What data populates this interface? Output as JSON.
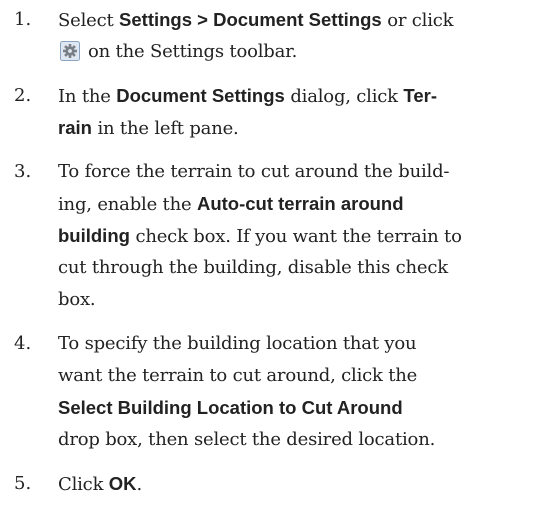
{
  "steps": [
    {
      "number": "1.",
      "line1": {
        "t1": "Select ",
        "b1": "Settings > Document Settings",
        "t2": " or click"
      },
      "line2": {
        "t1": "on the Settings toolbar."
      },
      "icon": "document-settings-gear-icon"
    },
    {
      "number": "2.",
      "line1": {
        "t1": "In the ",
        "b1": "Document Settings",
        "t2": " dialog, click ",
        "b2": "Ter-"
      },
      "line2": {
        "b1": "rain",
        "t1": " in the left pane."
      }
    },
    {
      "number": "3.",
      "line1": {
        "t1": "To force the terrain to cut around the build-"
      },
      "line2": {
        "t1": "ing, enable the ",
        "b1": "Auto-cut terrain around"
      },
      "line3": {
        "b1": "building",
        "t1": " check box. If you want the terrain to"
      },
      "line4": {
        "t1": "cut through the building, disable this check"
      },
      "line5": {
        "t1": "box."
      }
    },
    {
      "number": "4.",
      "line1": {
        "t1": "To specify the building location that you"
      },
      "line2": {
        "t1": "want the terrain to cut around, click the"
      },
      "line3": {
        "b1": "Select Building Location to Cut Around"
      },
      "line4": {
        "t1": "drop box, then select the desired location."
      }
    },
    {
      "number": "5.",
      "line1": {
        "t1": "Click ",
        "b1": "OK",
        "t2": "."
      }
    }
  ],
  "colors": {
    "text": "#222222",
    "icon_bg": "#dfe8f2",
    "icon_border": "#8aa4c0",
    "icon_gear": "#7a7f86"
  }
}
